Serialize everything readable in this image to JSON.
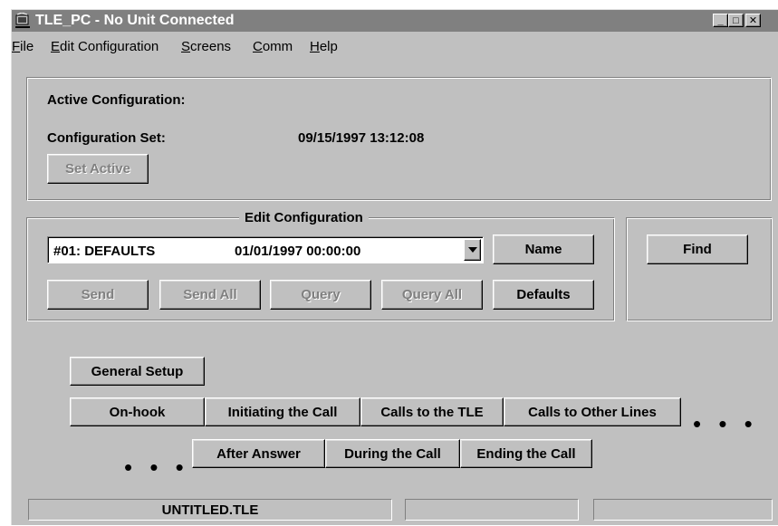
{
  "window": {
    "title": "TLE_PC - No Unit Connected",
    "controls": {
      "minimize": "_",
      "maximize": "□",
      "close": "✕"
    }
  },
  "menu": {
    "items": [
      {
        "label_u": "F",
        "label_rest": "ile"
      },
      {
        "label_u": "E",
        "label_rest": "dit Configuration"
      },
      {
        "label_u": "S",
        "label_rest": "creens"
      },
      {
        "label_u": "C",
        "label_rest": "omm"
      },
      {
        "label_u": "H",
        "label_rest": "elp"
      }
    ]
  },
  "active_config": {
    "heading": "Active Configuration:",
    "set_label": "Configuration Set:",
    "set_value": "09/15/1997 13:12:08",
    "set_active_button": "Set Active"
  },
  "edit_config": {
    "title": "Edit Configuration",
    "selected_name": "#01: DEFAULTS",
    "selected_date": "01/01/1997 00:00:00",
    "name_button": "Name",
    "send_button": "Send",
    "send_all_button": "Send All",
    "query_button": "Query",
    "query_all_button": "Query All",
    "defaults_button": "Defaults"
  },
  "find_button": "Find",
  "screens": {
    "general_setup": "General Setup",
    "on_hook": "On-hook",
    "initiating_call": "Initiating the Call",
    "calls_to_tle": "Calls to the TLE",
    "calls_other_lines": "Calls to Other Lines",
    "after_answer": "After Answer",
    "during_call": "During the Call",
    "ending_call": "Ending the Call",
    "continuation_dots": "• • •"
  },
  "status": {
    "file": "UNTITLED.TLE",
    "panel2": "",
    "panel3": ""
  },
  "icons": [
    "app-icon",
    "minimize-icon",
    "maximize-icon",
    "close-icon",
    "dropdown-arrow-icon"
  ]
}
